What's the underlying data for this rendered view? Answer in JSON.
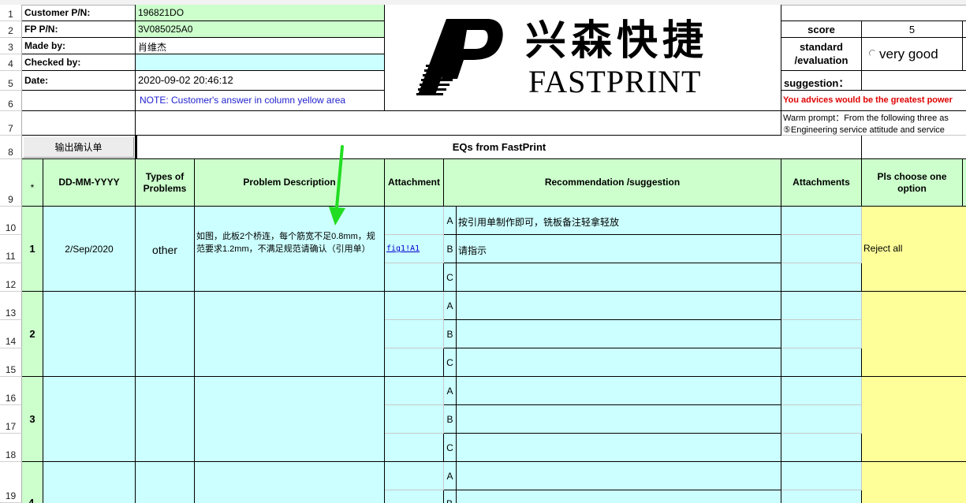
{
  "header": {
    "customer_pn_label": "Customer P/N:",
    "customer_pn_value": "196821DO",
    "fp_pn_label": "FP P/N:",
    "fp_pn_value": "3V085025A0",
    "made_by_label": "Made by:",
    "made_by_value": "肖维杰",
    "checked_by_label": "Checked by:",
    "checked_by_value": "",
    "date_label": "Date:",
    "date_value": "2020-09-02 20:46:12",
    "note": "NOTE: Customer's  answer in column yellow area"
  },
  "logo": {
    "chinese": "兴森快捷",
    "english": "FASTPRINT"
  },
  "right_panel": {
    "score_label": "score",
    "score_value": "5",
    "standard_label_1": "standard",
    "standard_label_2": "/evaluation",
    "evaluation_value": "very good",
    "suggestion_label": "suggestion：",
    "advice_text": "You advices would be the greatest power",
    "warm_prompt": "Warm prompt：From the following three as",
    "engineering_text": "⑤Engineering service attitude and service"
  },
  "output_button": "输出确认单",
  "eq_title": "EQs from FastPrint",
  "columns": {
    "star": "*",
    "date": "DD-MM-YYYY",
    "types": "Types of Problems",
    "problem": "Problem Description",
    "attachment": "Attachment",
    "recommendation": "Recommendation /suggestion",
    "attachments": "Attachments",
    "choose": "Pls choose one option"
  },
  "row_numbers": [
    "1",
    "2",
    "3",
    "4",
    "5",
    "6",
    "7",
    "8",
    "9",
    "10",
    "11",
    "12",
    "13",
    "14",
    "15",
    "16",
    "17",
    "18",
    "19"
  ],
  "entries": [
    {
      "num": "1",
      "date": "2/Sep/2020",
      "type": "other",
      "problem": "如图，此板2个桥连，每个筋宽不足0.8mm，规范要求1.2mm，不满足规范请确认（引用单）",
      "attachment_link": "fig1!A1",
      "options": [
        "按引用单制作即可，铣板备注轻拿轻放",
        "请指示",
        ""
      ],
      "choice": "Reject all"
    },
    {
      "num": "2",
      "date": "",
      "type": "",
      "problem": "",
      "attachment_link": "",
      "options": [
        "",
        "",
        ""
      ],
      "choice": ""
    },
    {
      "num": "3",
      "date": "",
      "type": "",
      "problem": "",
      "attachment_link": "",
      "options": [
        "",
        "",
        ""
      ],
      "choice": ""
    },
    {
      "num": "4",
      "date": "",
      "type": "",
      "problem": "",
      "attachment_link": "",
      "options": [
        "",
        ""
      ],
      "choice": ""
    }
  ],
  "option_letters": [
    "A",
    "B",
    "C"
  ],
  "colors": {
    "green": "#ccffcc",
    "cyan": "#ccffff",
    "yellow": "#ffff99",
    "note_blue": "#1f1fcf",
    "advice_red": "#e00000",
    "arrow_green": "#22dd22"
  }
}
